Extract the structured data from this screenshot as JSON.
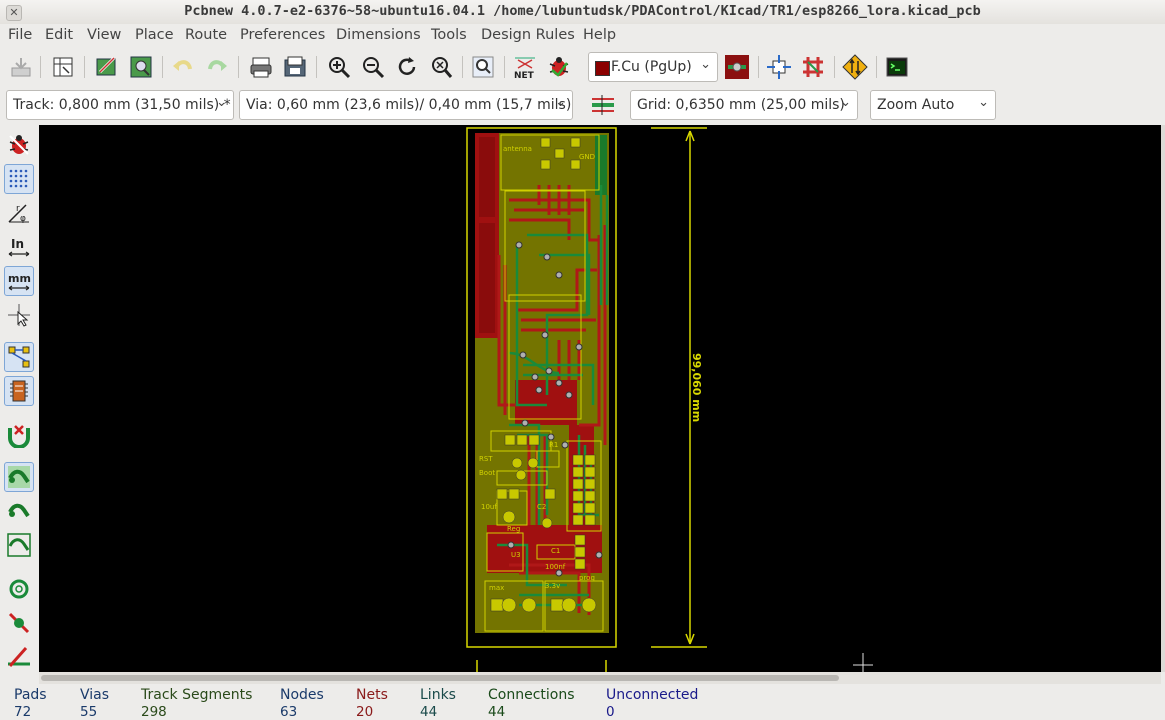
{
  "window": {
    "title": "Pcbnew 4.0.7-e2-6376~58~ubuntu16.04.1 /home/lubuntudsk/PDAControl/KIcad/TR1/esp8266_lora.kicad_pcb"
  },
  "menu": {
    "items": [
      "File",
      "Edit",
      "View",
      "Place",
      "Route",
      "Preferences",
      "Dimensions",
      "Tools",
      "Design Rules",
      "Help"
    ]
  },
  "toolbar": {
    "layer_select": "F.Cu (PgUp)",
    "layer_color": "#8b0000"
  },
  "toolbar2": {
    "track": "Track: 0,800 mm (31,50 mils) *",
    "via": "Via: 0,60 mm (23,6 mils)/ 0,40 mm (15,7 mils) *",
    "grid": "Grid: 0,6350 mm (25,00 mils)",
    "zoom": "Zoom Auto"
  },
  "left_toolbar": {
    "units_in": "In",
    "units_mm": "mm"
  },
  "board": {
    "dimension_label": "99,060 mm",
    "silkscreen": {
      "antenna": "antenna",
      "gnd": "GND",
      "r1": "R1",
      "c2": "C2",
      "c1": "C1",
      "c1_value": "100nf",
      "cap_10uf": "10uf",
      "u3": "U3",
      "reg": "Reg",
      "v33": "3.3v",
      "max": "max",
      "rst": "RST",
      "boot": "Boot",
      "prog": "prog"
    },
    "colors": {
      "copper_front": "#a01212",
      "copper_back": "#1a8a3a",
      "fill": "#7a7a00",
      "silk": "#d0d000",
      "edge": "#e0e000"
    }
  },
  "status": {
    "pads_label": "Pads",
    "pads": "72",
    "vias_label": "Vias",
    "vias": "55",
    "tracks_label": "Track Segments",
    "tracks": "298",
    "nodes_label": "Nodes",
    "nodes": "63",
    "nets_label": "Nets",
    "nets": "20",
    "links_label": "Links",
    "links": "44",
    "connections_label": "Connections",
    "connections": "44",
    "unconnected_label": "Unconnected",
    "unconnected": "0"
  }
}
